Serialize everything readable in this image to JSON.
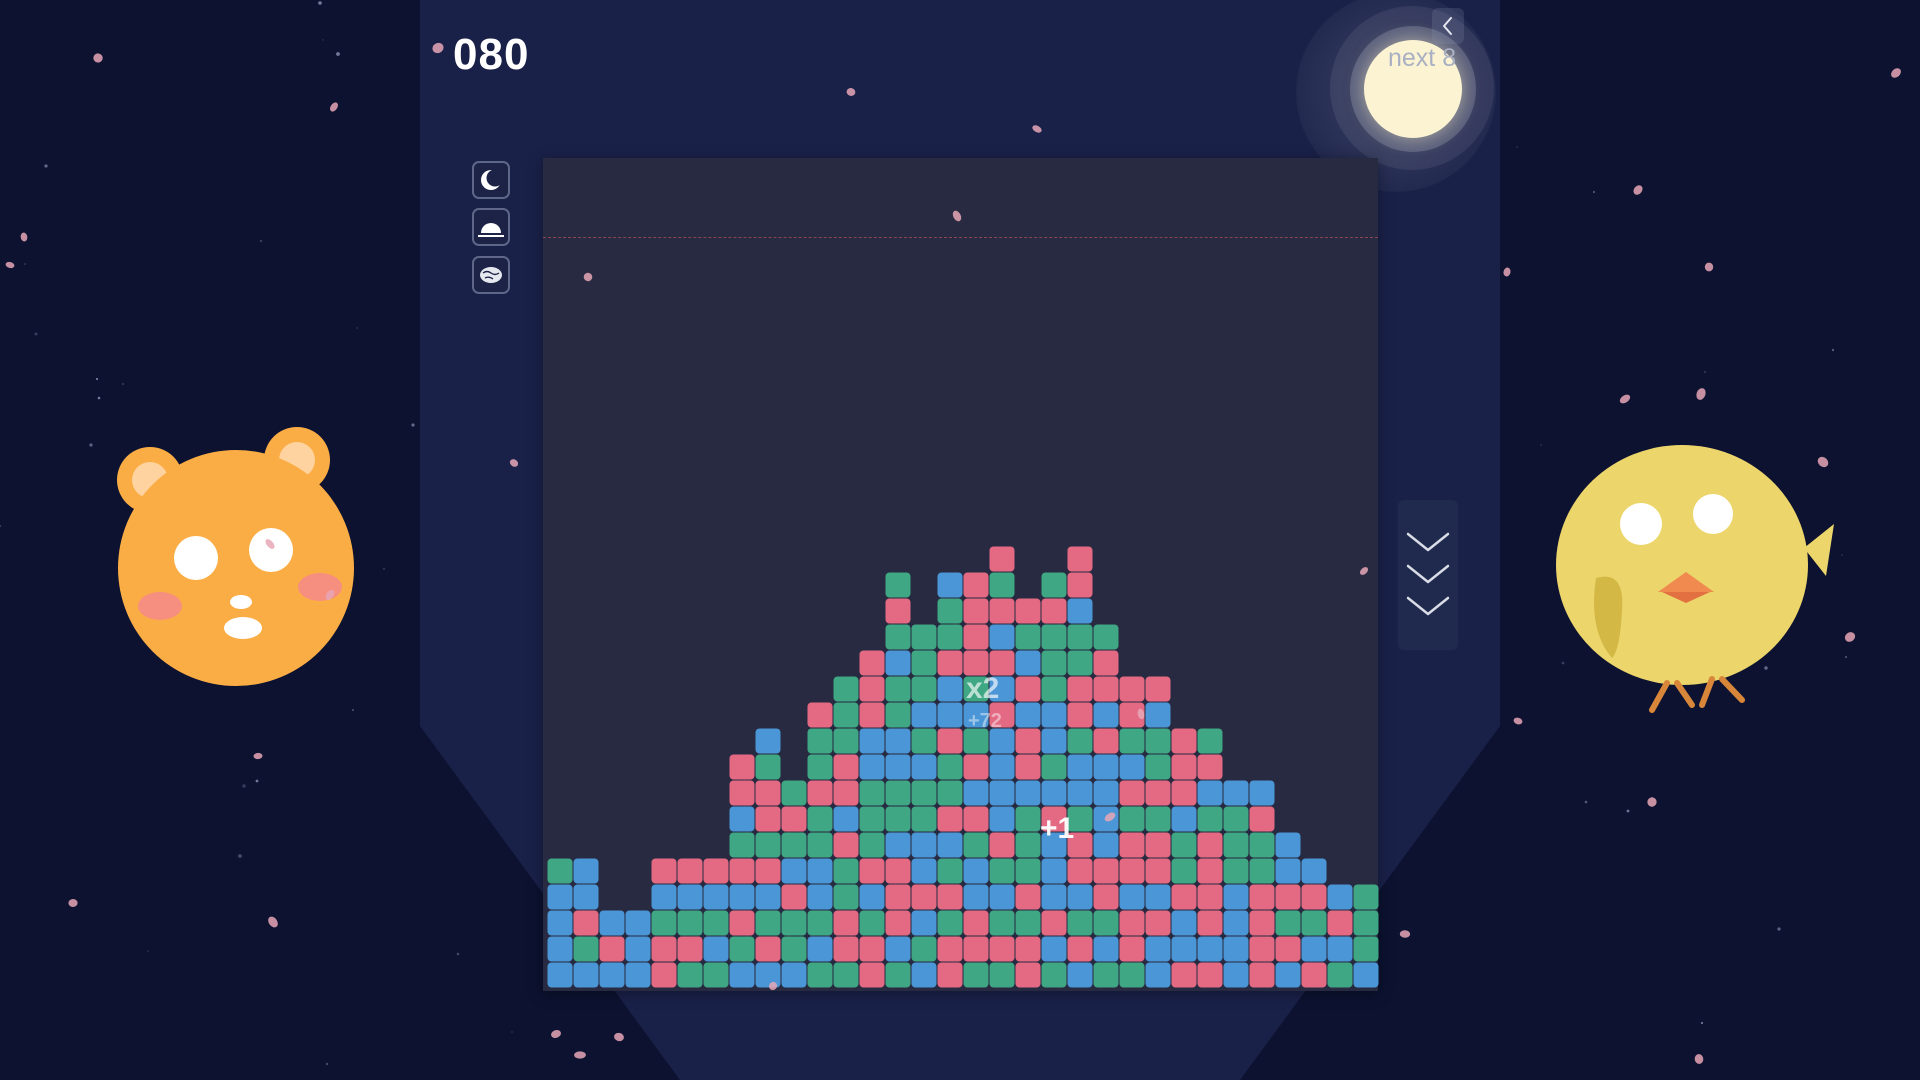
{
  "score": "080",
  "next_label": "next",
  "next_value": "8",
  "combo_multiplier": "x2",
  "combo_points": "+72",
  "float_plus": "+1",
  "controls": {
    "moon_mode_icon": "crescent-moon-icon",
    "sunrise_mode_icon": "sunrise-icon",
    "brain_mode_icon": "brain-icon",
    "back_icon": "chevron-left-icon",
    "drop_icon": "triple-chevron-down-icon"
  },
  "colors": {
    "background": "#0c1230",
    "panel": "#1a2149",
    "board": "#272a40",
    "block_pink": "#e46a83",
    "block_green": "#3fa784",
    "block_blue": "#4a96d6",
    "mascot_bear": "#fbad45",
    "mascot_chick": "#ecd56a",
    "petal": "#e8a7b6"
  },
  "mascots": {
    "left": "orange-bear",
    "right": "yellow-chick"
  },
  "board": {
    "cols": 32,
    "rows": 32,
    "heights": [
      5,
      5,
      3,
      3,
      5,
      5,
      5,
      9,
      10,
      8,
      11,
      12,
      13,
      16,
      14,
      16,
      16,
      17,
      15,
      16,
      17,
      14,
      12,
      12,
      10,
      10,
      8,
      8,
      6,
      5,
      4,
      4
    ]
  }
}
